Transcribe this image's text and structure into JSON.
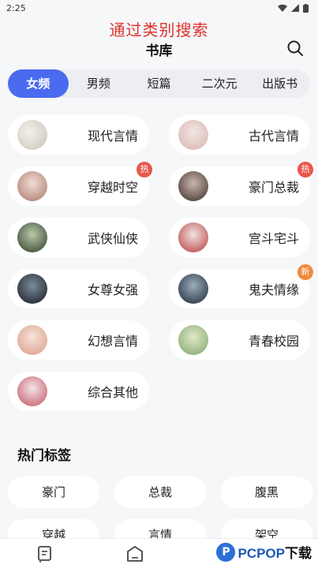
{
  "status": {
    "time": "2:25"
  },
  "overlay_caption": "通过类别搜索",
  "header": {
    "title": "书库"
  },
  "tabs": [
    {
      "label": "女频",
      "active": true
    },
    {
      "label": "男频",
      "active": false
    },
    {
      "label": "短篇",
      "active": false
    },
    {
      "label": "二次元",
      "active": false
    },
    {
      "label": "出版书",
      "active": false
    }
  ],
  "categories": [
    {
      "label": "现代言情",
      "badge": ""
    },
    {
      "label": "古代言情",
      "badge": ""
    },
    {
      "label": "穿越时空",
      "badge": "热"
    },
    {
      "label": "豪门总裁",
      "badge": "热"
    },
    {
      "label": "武侠仙侠",
      "badge": ""
    },
    {
      "label": "宫斗宅斗",
      "badge": ""
    },
    {
      "label": "女尊女强",
      "badge": ""
    },
    {
      "label": "鬼夫情缘",
      "badge": "新"
    },
    {
      "label": "幻想言情",
      "badge": ""
    },
    {
      "label": "青春校园",
      "badge": ""
    },
    {
      "label": "综合其他",
      "badge": ""
    }
  ],
  "hot_tags": {
    "title": "热门标签",
    "items": [
      "豪门",
      "总裁",
      "腹黑",
      "穿越",
      "言情",
      "架空"
    ]
  },
  "watermark": {
    "logo": "P",
    "brand": "PCPOP",
    "suffix": "下载"
  },
  "colors": {
    "accent": "#4a6af0",
    "caption": "#e0312c",
    "hot_badge": "#e9574b",
    "new_badge": "#f08a3c"
  }
}
